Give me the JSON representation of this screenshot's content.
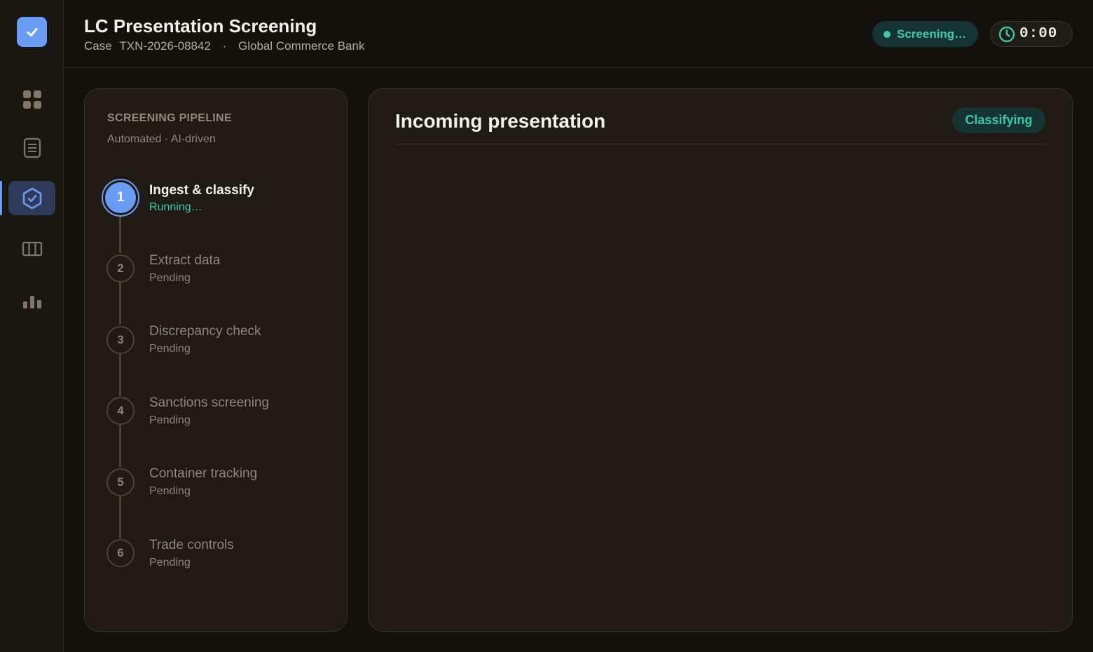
{
  "header": {
    "title": "LC Presentation Screening",
    "case_label": "Case",
    "case_id": "TXN-2026-08842",
    "separator": "·",
    "bank": "Global Commerce Bank",
    "status": "Screening…",
    "timer": "0:00"
  },
  "nav": {
    "items": [
      "dashboard-icon",
      "document-icon",
      "shield-check-icon",
      "columns-icon",
      "bar-chart-icon"
    ],
    "active": "shield-check-icon"
  },
  "pipeline": {
    "title": "SCREENING PIPELINE",
    "subtitle": "Automated · AI-driven",
    "steps": [
      {
        "number": "1",
        "name": "Ingest & classify",
        "status": "Running…"
      },
      {
        "number": "2",
        "name": "Extract data",
        "status": "Pending"
      },
      {
        "number": "3",
        "name": "Discrepancy check",
        "status": "Pending"
      },
      {
        "number": "4",
        "name": "Sanctions screening",
        "status": "Pending"
      },
      {
        "number": "5",
        "name": "Container tracking",
        "status": "Pending"
      },
      {
        "number": "6",
        "name": "Trade controls",
        "status": "Pending"
      }
    ]
  },
  "main": {
    "title": "Incoming presentation",
    "badge": "Classifying"
  },
  "colors": {
    "accent": "#6b9cf5",
    "teal": "#3cc9ac",
    "background": "#14110d",
    "panel": "#1f1a13"
  }
}
